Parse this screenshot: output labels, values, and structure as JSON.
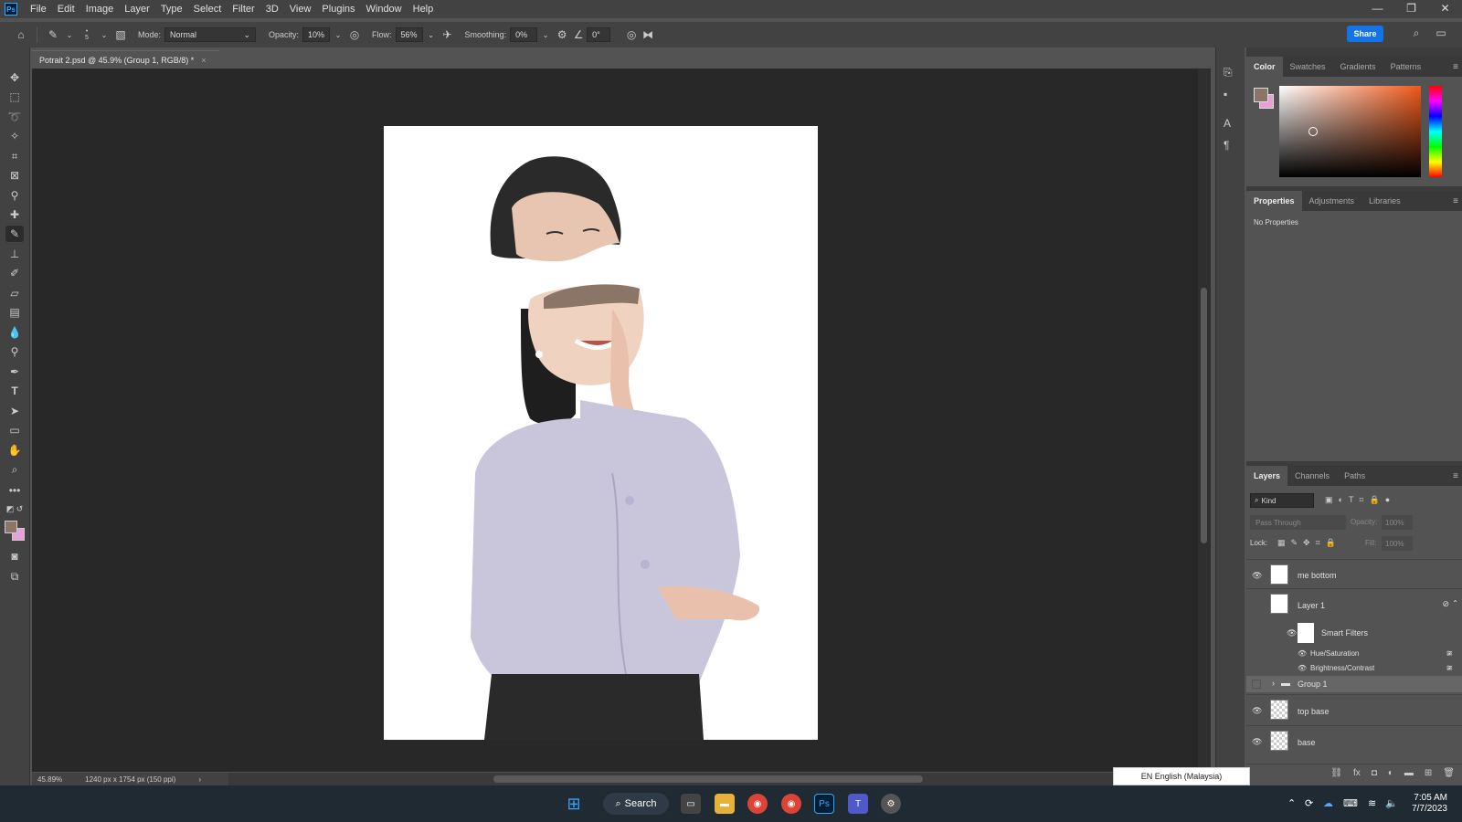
{
  "menu": {
    "logo": "Ps",
    "items": [
      "File",
      "Edit",
      "Image",
      "Layer",
      "Type",
      "Select",
      "Filter",
      "3D",
      "View",
      "Plugins",
      "Window",
      "Help"
    ]
  },
  "window_controls": {
    "minimize": "—",
    "restore": "❐",
    "close": "✕"
  },
  "options": {
    "brush_size": "5",
    "mode_label": "Mode:",
    "mode_value": "Normal",
    "opacity_label": "Opacity:",
    "opacity_value": "10%",
    "flow_label": "Flow:",
    "flow_value": "56%",
    "smoothing_label": "Smoothing:",
    "smoothing_value": "0%",
    "angle_value": "0°",
    "share_label": "Share"
  },
  "document": {
    "tab_title": "Potrait 2.psd @ 45.9% (Group 1, RGB/8) *",
    "tab_close": "×",
    "zoom": "45.89%",
    "dimensions": "1240 px x 1754 px (150 ppi)"
  },
  "color_panel": {
    "tabs": [
      "Color",
      "Swatches",
      "Gradients",
      "Patterns"
    ],
    "foreground": "#8a7566",
    "background": "#e8a0d8"
  },
  "properties_panel": {
    "tabs": [
      "Properties",
      "Adjustments",
      "Libraries"
    ],
    "empty_text": "No Properties"
  },
  "layers_panel": {
    "tabs": [
      "Layers",
      "Channels",
      "Paths"
    ],
    "filter_kind": "Kind",
    "blend_mode": "Pass Through",
    "opacity_label": "Opacity:",
    "opacity_value": "100%",
    "lock_label": "Lock:",
    "fill_label": "Fill:",
    "fill_value": "100%",
    "layers": [
      {
        "name": "me bottom"
      },
      {
        "name": "Layer 1"
      },
      {
        "name": "Smart Filters"
      },
      {
        "name": "Hue/Saturation"
      },
      {
        "name": "Brightness/Contrast"
      },
      {
        "name": "Group 1"
      },
      {
        "name": "top base"
      },
      {
        "name": "base"
      }
    ]
  },
  "language_popup": "EN English (Malaysia)",
  "taskbar": {
    "search_label": "Search",
    "time": "7:05 AM",
    "date": "7/7/2023"
  },
  "colors": {
    "accent": "#1473e6",
    "panel_bg": "#535353",
    "canvas_bg": "#282828"
  }
}
